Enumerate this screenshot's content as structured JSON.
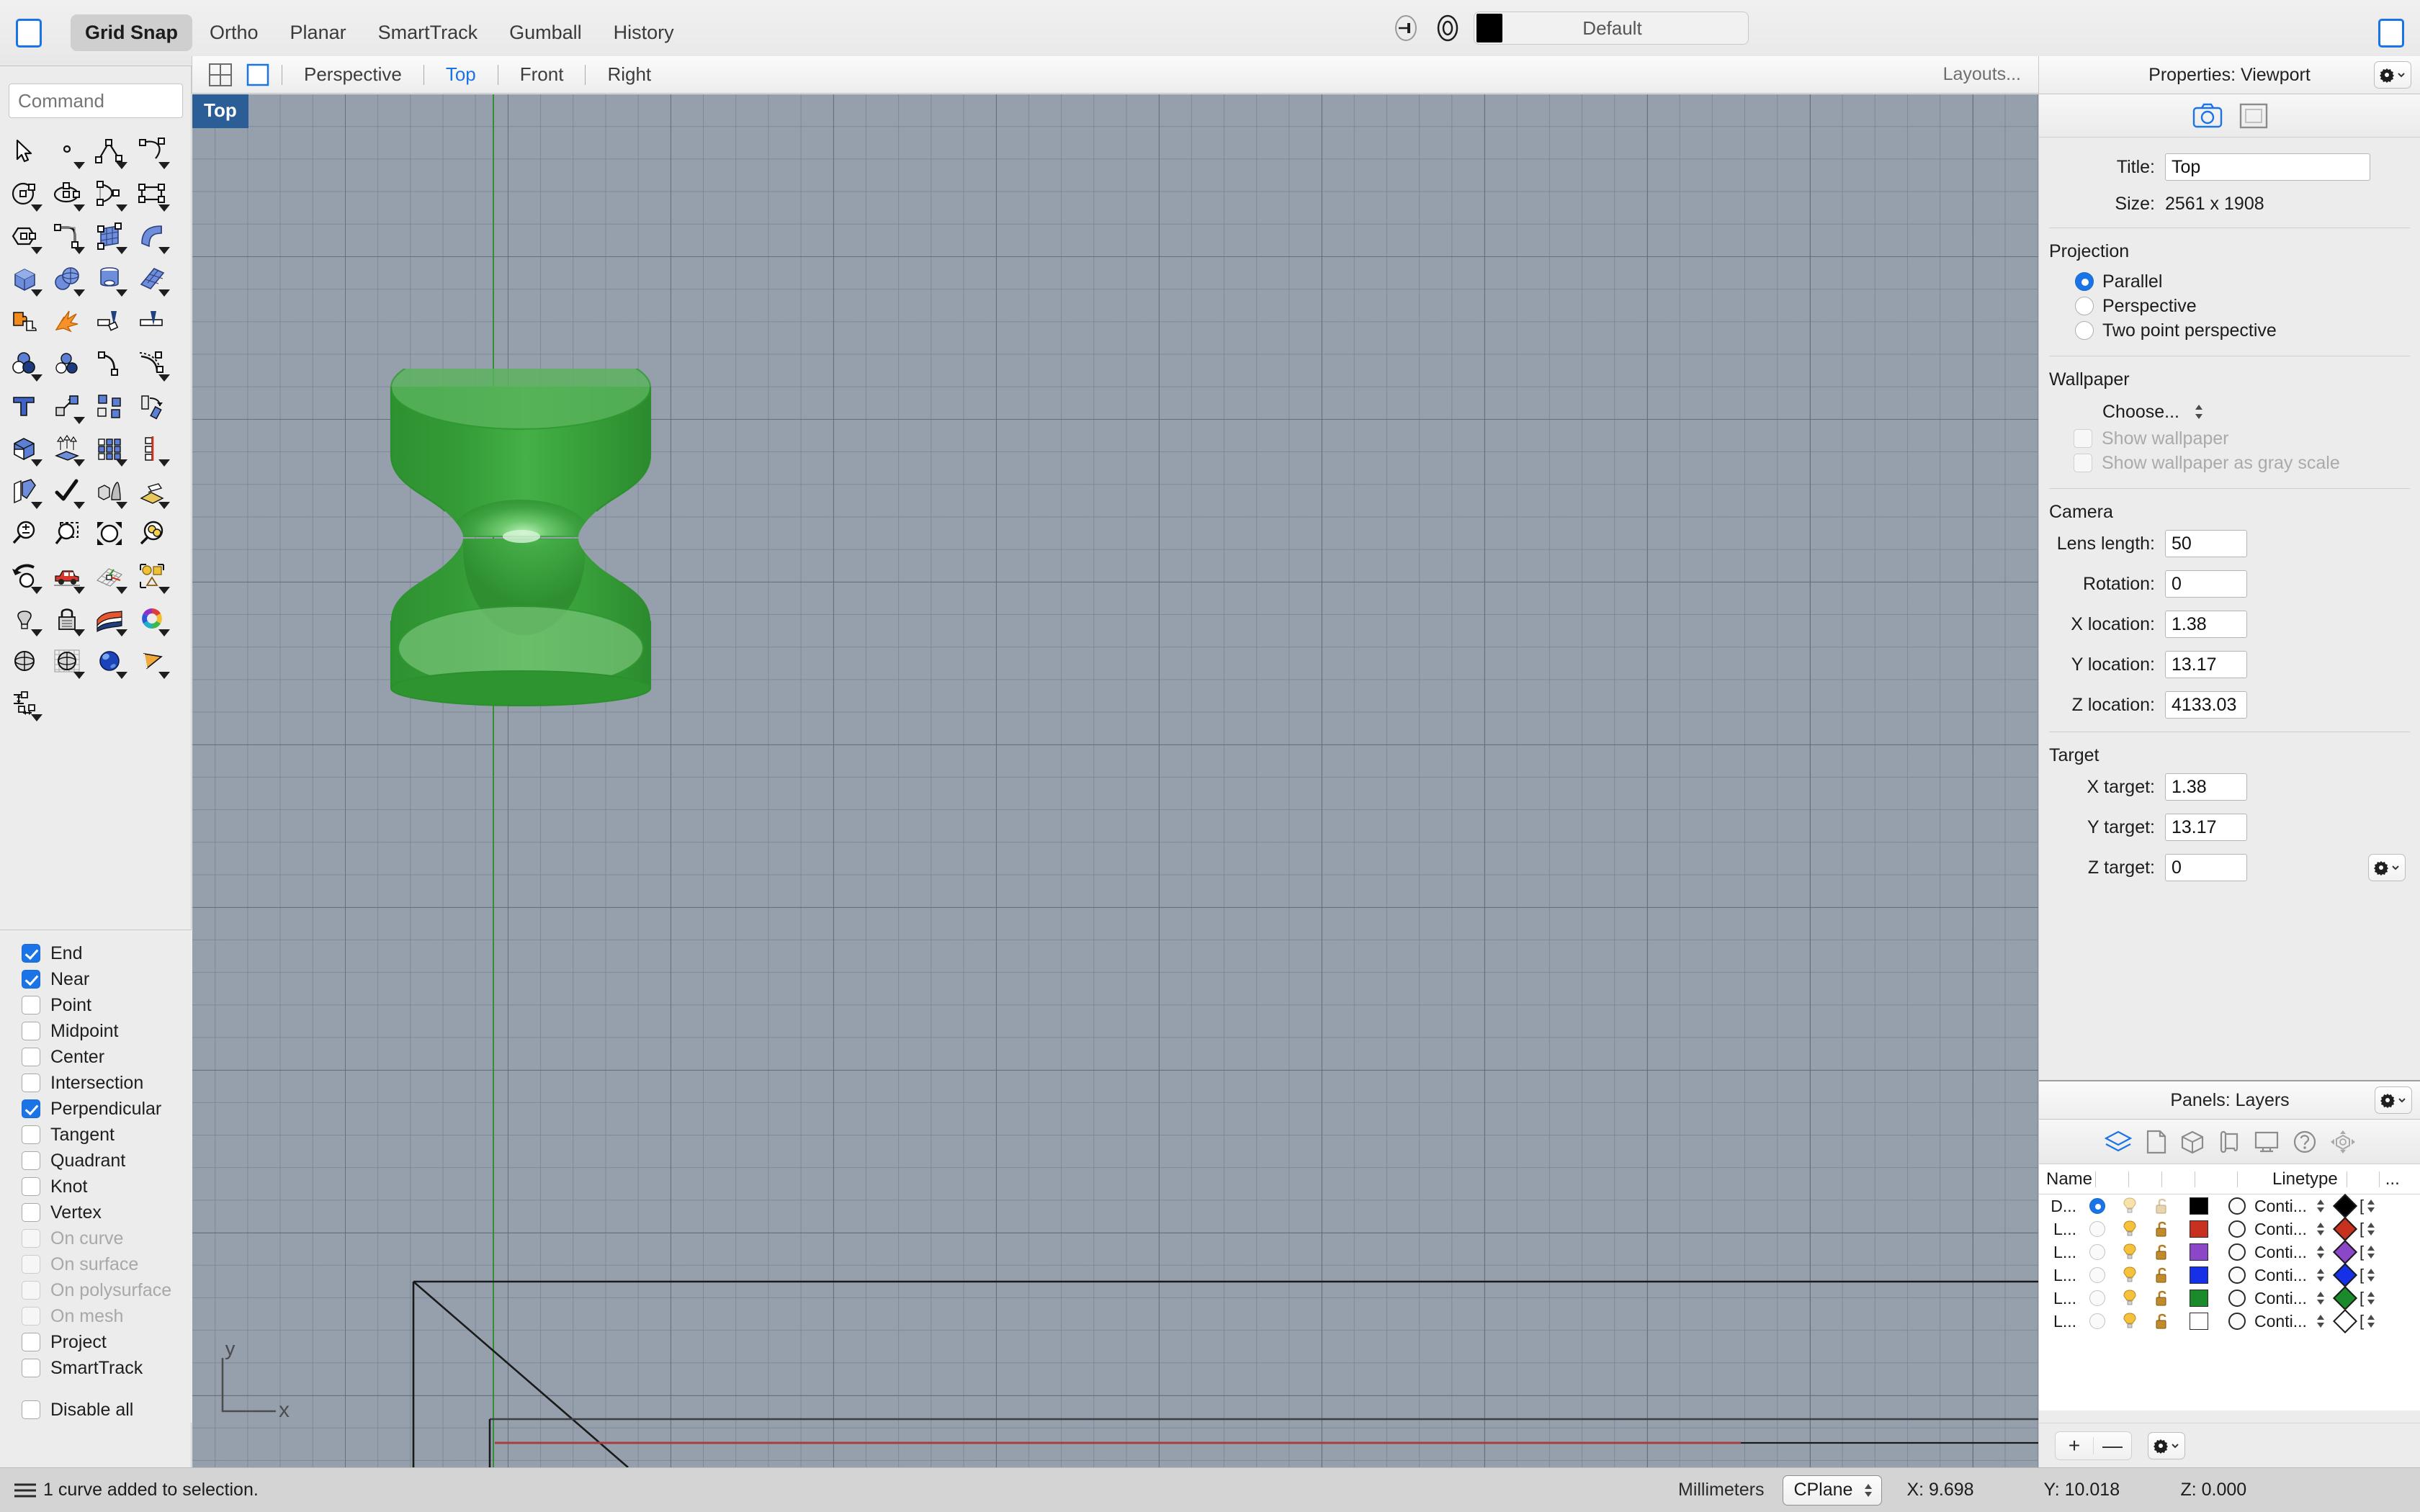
{
  "topbar": {
    "left_panel_toggle": "left-panel-toggle",
    "toggles": [
      {
        "label": "Grid Snap",
        "active": true
      },
      {
        "label": "Ortho",
        "active": false
      },
      {
        "label": "Planar",
        "active": false
      },
      {
        "label": "SmartTrack",
        "active": false
      },
      {
        "label": "Gumball",
        "active": false
      },
      {
        "label": "History",
        "active": false
      }
    ],
    "layer_name": "Default",
    "layer_color": "#000000"
  },
  "viewport_tabs": {
    "labels": [
      {
        "label": "Perspective",
        "active": false
      },
      {
        "label": "Top",
        "active": true
      },
      {
        "label": "Front",
        "active": false
      },
      {
        "label": "Right",
        "active": false
      }
    ],
    "layouts": "Layouts..."
  },
  "command": {
    "placeholder": "Command",
    "value": ""
  },
  "viewport": {
    "badge": "Top",
    "axis_x_label": "x",
    "axis_y_label": "y",
    "background_color": "#96a0ad",
    "object_color": "#3aa33a"
  },
  "osnap": {
    "items": [
      {
        "label": "End",
        "checked": true,
        "disabled": false
      },
      {
        "label": "Near",
        "checked": true,
        "disabled": false
      },
      {
        "label": "Point",
        "checked": false,
        "disabled": false
      },
      {
        "label": "Midpoint",
        "checked": false,
        "disabled": false
      },
      {
        "label": "Center",
        "checked": false,
        "disabled": false
      },
      {
        "label": "Intersection",
        "checked": false,
        "disabled": false
      },
      {
        "label": "Perpendicular",
        "checked": true,
        "disabled": false
      },
      {
        "label": "Tangent",
        "checked": false,
        "disabled": false
      },
      {
        "label": "Quadrant",
        "checked": false,
        "disabled": false
      },
      {
        "label": "Knot",
        "checked": false,
        "disabled": false
      },
      {
        "label": "Vertex",
        "checked": false,
        "disabled": false
      },
      {
        "label": "On curve",
        "checked": false,
        "disabled": true
      },
      {
        "label": "On surface",
        "checked": false,
        "disabled": true
      },
      {
        "label": "On polysurface",
        "checked": false,
        "disabled": true
      },
      {
        "label": "On mesh",
        "checked": false,
        "disabled": true
      },
      {
        "label": "Project",
        "checked": false,
        "disabled": false
      },
      {
        "label": "SmartTrack",
        "checked": false,
        "disabled": false
      }
    ],
    "disable_all": {
      "label": "Disable all",
      "checked": false
    }
  },
  "properties": {
    "header": "Properties: Viewport",
    "title_label": "Title:",
    "title_value": "Top",
    "size_label": "Size:",
    "size_value": "2561 x 1908",
    "projection": {
      "title": "Projection",
      "options": [
        {
          "label": "Parallel",
          "selected": true
        },
        {
          "label": "Perspective",
          "selected": false
        },
        {
          "label": "Two point perspective",
          "selected": false
        }
      ]
    },
    "wallpaper": {
      "title": "Wallpaper",
      "choose": "Choose...",
      "show_wallpaper": "Show wallpaper",
      "show_gray": "Show wallpaper as gray scale"
    },
    "camera": {
      "title": "Camera",
      "fields": [
        {
          "label": "Lens length:",
          "value": "50"
        },
        {
          "label": "Rotation:",
          "value": "0"
        },
        {
          "label": "X location:",
          "value": "1.38"
        },
        {
          "label": "Y location:",
          "value": "13.17"
        },
        {
          "label": "Z location:",
          "value": "4133.03"
        }
      ]
    },
    "target": {
      "title": "Target",
      "fields": [
        {
          "label": "X target:",
          "value": "1.38"
        },
        {
          "label": "Y target:",
          "value": "13.17"
        },
        {
          "label": "Z target:",
          "value": "0"
        }
      ]
    }
  },
  "layers": {
    "header": "Panels: Layers",
    "columns": {
      "name": "Name",
      "linetype": "Linetype",
      "more": "..."
    },
    "rows": [
      {
        "name": "D...",
        "current": true,
        "color": "#000000",
        "linetype": "Conti...",
        "print_color": "#000000"
      },
      {
        "name": "L...",
        "current": false,
        "color": "#c8301f",
        "linetype": "Conti...",
        "print_color": "#c8301f"
      },
      {
        "name": "L...",
        "current": false,
        "color": "#8c46c8",
        "linetype": "Conti...",
        "print_color": "#8c46c8"
      },
      {
        "name": "L...",
        "current": false,
        "color": "#1630e8",
        "linetype": "Conti...",
        "print_color": "#1630e8"
      },
      {
        "name": "L...",
        "current": false,
        "color": "#1a8a2a",
        "linetype": "Conti...",
        "print_color": "#1a8a2a"
      },
      {
        "name": "L...",
        "current": false,
        "color": "#ffffff",
        "linetype": "Conti...",
        "print_color": "#ffffff"
      }
    ],
    "footer": {
      "add": "+",
      "remove": "—"
    }
  },
  "statusbar": {
    "message": "1 curve added to selection.",
    "units": "Millimeters",
    "cplane": "CPlane",
    "x": "X: 9.698",
    "y": "Y: 10.018",
    "z": "Z: 0.000"
  }
}
